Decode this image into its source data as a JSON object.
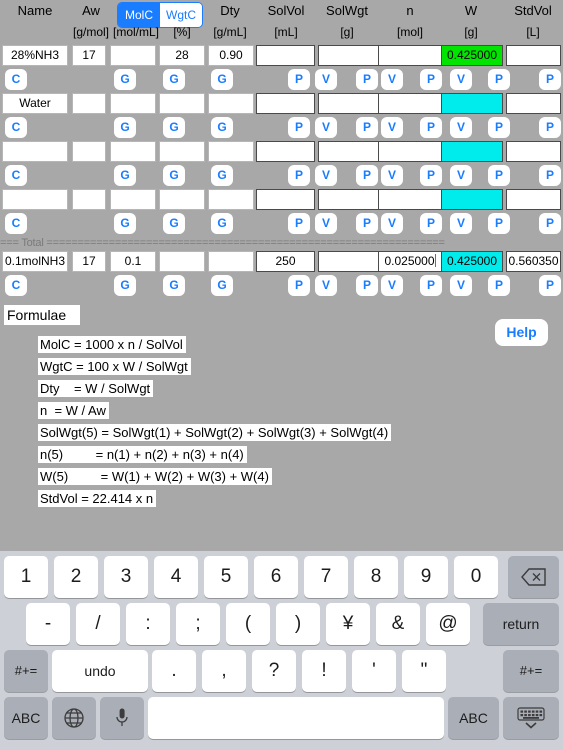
{
  "table": {
    "headers": [
      "Name",
      "Aw",
      "MolC",
      "WgtC",
      "Dty",
      "SolVol",
      "SolWgt",
      "n",
      "W",
      "StdVol"
    ],
    "units": [
      "",
      "[g/mol]",
      "[mol/mL]",
      "[%]",
      "[g/mL]",
      "[mL]",
      "[g]",
      "[mol]",
      "[g]",
      "[L]"
    ],
    "segmented": {
      "left_label": "MolC",
      "right_label": "WgtC",
      "selected": "MolC"
    },
    "rows": [
      {
        "name": "28%NH3",
        "aw": "17",
        "molc": "",
        "wgtc": "28",
        "dty": "0.90",
        "solvol": "",
        "solwgt": "",
        "n": "",
        "w": "0.425000",
        "stdvol": "",
        "w_highlight": "green"
      },
      {
        "name": "Water",
        "aw": "",
        "molc": "",
        "wgtc": "",
        "dty": "",
        "solvol": "",
        "solwgt": "",
        "n": "",
        "w": "",
        "stdvol": "",
        "w_highlight": "cyan"
      },
      {
        "name": "",
        "aw": "",
        "molc": "",
        "wgtc": "",
        "dty": "",
        "solvol": "",
        "solwgt": "",
        "n": "",
        "w": "",
        "stdvol": "",
        "w_highlight": "cyan"
      },
      {
        "name": "",
        "aw": "",
        "molc": "",
        "wgtc": "",
        "dty": "",
        "solvol": "",
        "solwgt": "",
        "n": "",
        "w": "",
        "stdvol": "",
        "w_highlight": "cyan"
      }
    ],
    "total_separator": "=== Total ================================================================",
    "total_row": {
      "name": "0.1molNH3",
      "aw": "17",
      "molc": "0.1",
      "wgtc": "",
      "dty": "",
      "solvol": "250",
      "solwgt": "",
      "n": "0.025000",
      "w": "0.425000",
      "stdvol": "0.560350",
      "w_highlight": "cyan",
      "n_focused": true
    },
    "row_buttons": {
      "clear": "C",
      "get": "G",
      "value": "V",
      "paste": "P"
    }
  },
  "formulae": {
    "title": "Formulae",
    "help_label": "Help",
    "lines": [
      "MolC = 1000 x n / SolVol",
      "WgtC = 100 x W / SolWgt",
      "Dty    = W / SolWgt",
      "n  = W / Aw",
      "SolWgt(5) = SolWgt(1) + SolWgt(2) + SolWgt(3) + SolWgt(4)",
      "n(5)         = n(1) + n(2) + n(3) + n(4)",
      "W(5)         = W(1) + W(2) + W(3) + W(4)",
      "StdVol = 22.414 x n"
    ]
  },
  "keyboard": {
    "row1": [
      "1",
      "2",
      "3",
      "4",
      "5",
      "6",
      "7",
      "8",
      "9",
      "0"
    ],
    "backspace": "delete-icon",
    "row2": [
      "-",
      "/",
      ":",
      ";",
      "(",
      ")",
      "¥",
      "&",
      "@"
    ],
    "return_label": "return",
    "row3_left": "#+=",
    "undo_label": "undo",
    "row3": [
      ".",
      ",",
      "?",
      "!",
      "'",
      "\""
    ],
    "row3_right": "#+=",
    "row4_abc_left": "ABC",
    "globe": "globe-icon",
    "mic": "microphone-icon",
    "space": "",
    "row4_abc_right": "ABC",
    "dismiss": "hide-keyboard-icon"
  },
  "colors": {
    "accent": "#1a7cff",
    "highlight_green": "#00e400",
    "highlight_cyan": "#00ecec",
    "page_bg": "#a8a8a8",
    "keyboard_bg": "#cdd0d6"
  }
}
